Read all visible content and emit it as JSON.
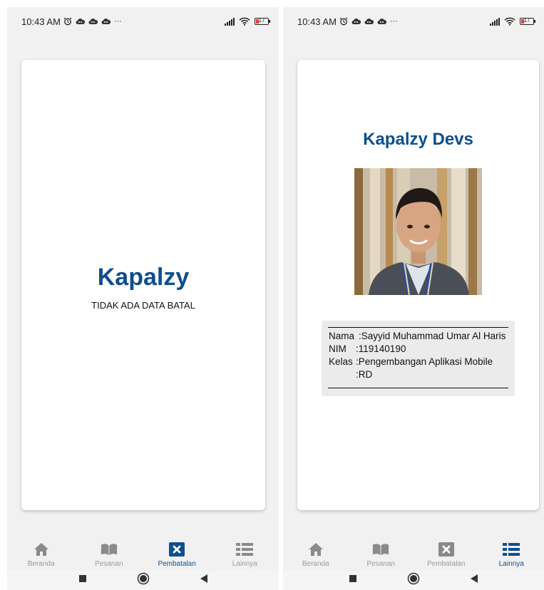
{
  "colors": {
    "brand": "#0d4f8f",
    "nav_inactive": "#9a9a9a",
    "background": "#f1f1f1",
    "battery_low": "#e53935"
  },
  "status_bar": {
    "time": "10:43 AM",
    "more": "···",
    "battery_level": "17",
    "icons": [
      "alarm-icon",
      "cloud-app-icon",
      "cloud-app-icon",
      "cloud-app-icon",
      "signal-icon",
      "wifi-icon",
      "battery-icon"
    ]
  },
  "left_screen": {
    "brand": "Kapalzy",
    "empty_message": "TIDAK ADA DATA BATAL"
  },
  "right_screen": {
    "title": "Kapalzy Devs",
    "profile": [
      {
        "key": "Nama",
        "value": "Sayyid Muhammad Umar Al Haris"
      },
      {
        "key": "NIM",
        "value": "119140190"
      },
      {
        "key": "Kelas",
        "value": "Pengembangan Aplikasi Mobile"
      },
      {
        "key": "",
        "value": "RD"
      }
    ]
  },
  "bottom_nav": {
    "items": [
      {
        "label": "Beranda",
        "icon": "home-icon"
      },
      {
        "label": "Pesanan",
        "icon": "book-icon"
      },
      {
        "label": "Pembatalan",
        "icon": "cancel-box-icon"
      },
      {
        "label": "Lainnya",
        "icon": "list-icon"
      }
    ],
    "left_active_index": 2,
    "right_active_index": 3
  },
  "system_nav": [
    "recents-button",
    "home-button",
    "back-button"
  ]
}
